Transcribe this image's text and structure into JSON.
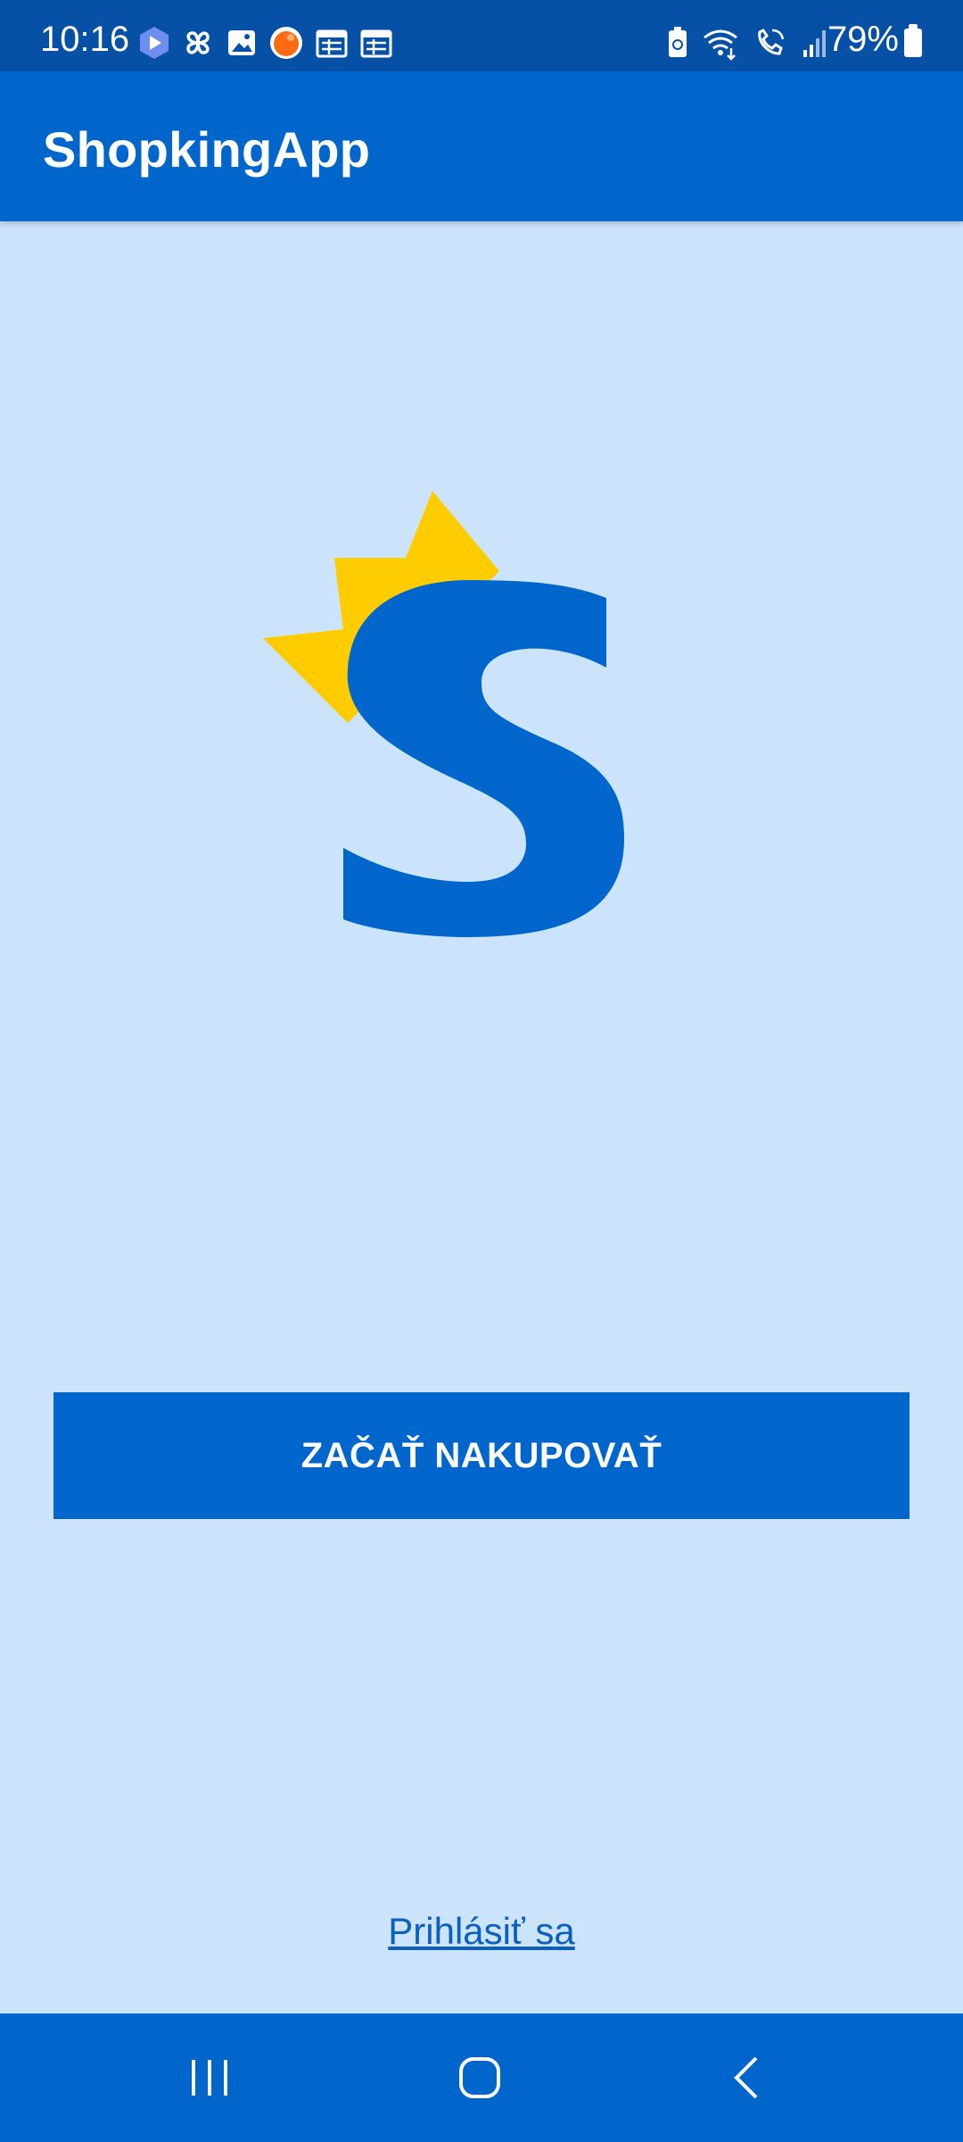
{
  "status_bar": {
    "time": "10:16",
    "battery_percent": "79%",
    "left_icons": [
      "camera-app-icon",
      "pinwheel-icon",
      "gallery-icon",
      "orange-app-icon",
      "calendar-icon",
      "calendar-icon"
    ],
    "right_icons": [
      "battery-saver-icon",
      "wifi-calling-icon",
      "wifi-signal-icon",
      "cell-signal-icon",
      "battery-icon"
    ]
  },
  "app_bar": {
    "title": "ShopkingApp"
  },
  "logo": {
    "letter": "S",
    "colors": {
      "letter": "#0066cc",
      "crown": "#ffcc00"
    }
  },
  "main": {
    "start_shopping_label": "ZAČAŤ NAKUPOVAŤ",
    "login_label": "Prihlásiť sa"
  },
  "nav_bar": {
    "buttons": [
      "recents-icon",
      "home-icon",
      "back-icon"
    ]
  },
  "colors": {
    "background": "#cbe3fb",
    "primary": "#0066cc",
    "status_bar": "#0651a6",
    "crown": "#ffcc00"
  }
}
